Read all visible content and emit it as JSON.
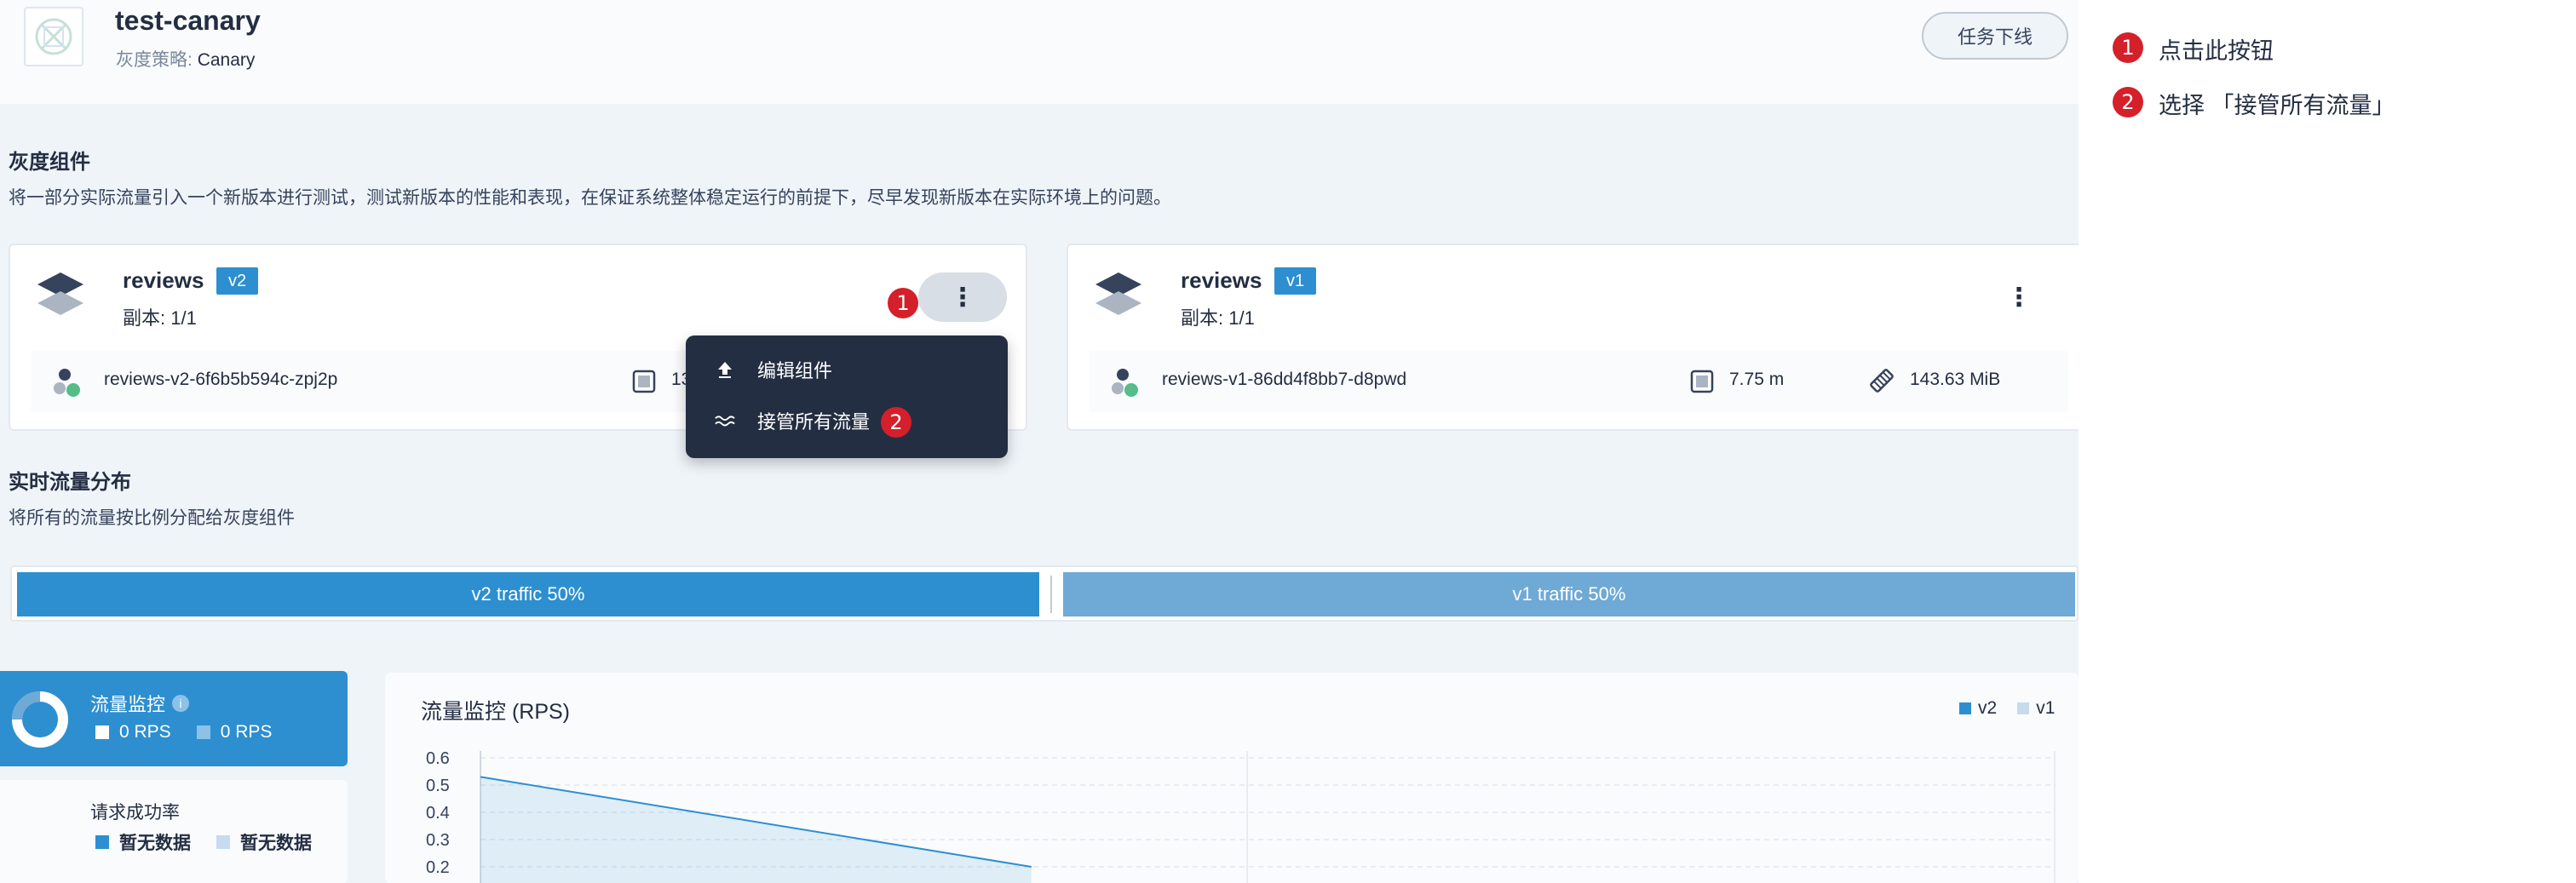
{
  "header": {
    "app_name": "test-canary",
    "strategy_label": "灰度策略:",
    "strategy_value": "Canary",
    "offline_button": "任务下线"
  },
  "canary_section": {
    "title": "灰度组件",
    "description": "将一部分实际流量引入一个新版本进行测试，测试新版本的性能和表现，在保证系统整体稳定运行的前提下，尽早发现新版本在实际环境上的问题。"
  },
  "components": [
    {
      "name": "reviews",
      "version": "v2",
      "replicas": "副本: 1/1",
      "pod": "reviews-v2-6f6b5b594c-zpj2p",
      "cpu": "13."
    },
    {
      "name": "reviews",
      "version": "v1",
      "replicas": "副本: 1/1",
      "pod": "reviews-v1-86dd4f8bb7-d8pwd",
      "cpu": "7.75 m",
      "memory": "143.63 MiB"
    }
  ],
  "dropdown": {
    "items": [
      {
        "label": "编辑组件",
        "icon": "upload-icon"
      },
      {
        "label": "接管所有流量",
        "icon": "traffic-wave-icon"
      }
    ]
  },
  "traffic_section": {
    "title": "实时流量分布",
    "description": "将所有的流量按比例分配给灰度组件",
    "v2_label": "v2 traffic 50%",
    "v1_label": "v1 traffic 50%",
    "v2_share": 50,
    "v1_share": 50
  },
  "monitor": {
    "title": "流量监控",
    "v2_rps": "0 RPS",
    "v1_rps": "0 RPS",
    "success_title": "请求成功率",
    "no_data_1": "暂无数据",
    "no_data_2": "暂无数据"
  },
  "chart_data": {
    "type": "area",
    "title": "流量监控 (RPS)",
    "legend": [
      "v2",
      "v1"
    ],
    "legend_position": "top-right",
    "y_ticks": [
      "0.6",
      "0.5",
      "0.4",
      "0.3",
      "0.2"
    ],
    "ylim": [
      0.2,
      0.6
    ],
    "grid": true,
    "series": [
      {
        "name": "v2",
        "points": [
          [
            0,
            0.53
          ],
          [
            0.35,
            0.2
          ]
        ]
      }
    ]
  },
  "markers": [
    "1",
    "2"
  ],
  "instructions": [
    {
      "num": "1",
      "text": "点击此按钮"
    },
    {
      "num": "2",
      "text": "选择 「接管所有流量」"
    }
  ],
  "colors": {
    "primary": "#2d8fd0",
    "light_primary": "#6fa9d6",
    "dark": "#242e42",
    "marker_red": "#d4202a",
    "background": "#eff4f9"
  }
}
